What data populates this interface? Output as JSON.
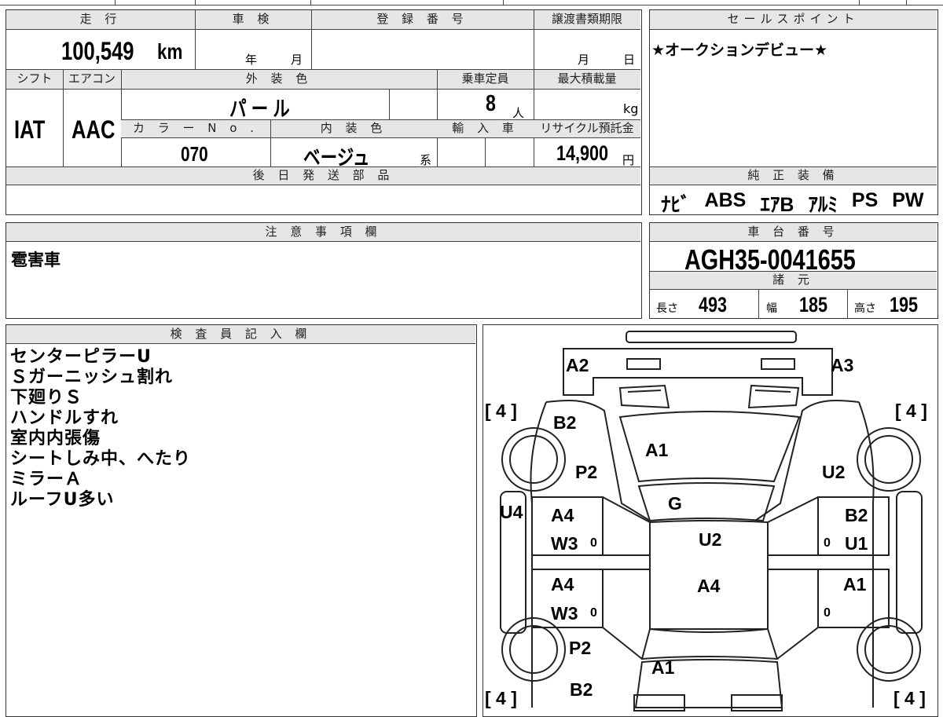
{
  "headers": {
    "mileage": "走 行",
    "inspection": "車 検",
    "registration": "登 録 番 号",
    "transfer_deadline": "譲渡書類期限",
    "sales_point": "セールスポイント",
    "shift": "シフト",
    "aircon": "エアコン",
    "exterior_color": "外 装 色",
    "capacity": "乗車定員",
    "max_load": "最大積載量",
    "color_no": "カ ラ ー N o .",
    "interior_color": "内 装 色",
    "import": "輸 入 車",
    "recycle": "リサイクル預託金",
    "later_parts": "後 日 発 送 部 品",
    "factory_equipment": "純 正 装 備",
    "notes": "注 意 事 項 欄",
    "chassis_no": "車 台 番 号",
    "specs": "諸 元",
    "inspector": "検 査 員 記 入 欄"
  },
  "values": {
    "mileage": "100,549",
    "mileage_unit": "km",
    "inspection_year": "年",
    "inspection_month": "月",
    "transfer_month": "月",
    "transfer_day": "日",
    "sales_point": "★オークションデビュー★",
    "shift": "IAT",
    "aircon": "AAC",
    "exterior_color": "パ ー ル",
    "capacity": "8",
    "capacity_unit": "人",
    "max_load_unit": "kg",
    "color_no": "070",
    "interior_color": "ベージュ",
    "interior_suffix": "系",
    "recycle": "14,900",
    "recycle_unit": "円",
    "equipment": [
      "ﾅﾋﾞ",
      "ABS",
      "ｴｱB",
      "ｱﾙﾐ",
      "PS",
      "PW"
    ],
    "notes": "雹害車",
    "chassis_no": "AGH35-0041655",
    "length_label": "長さ",
    "length": "493",
    "width_label": "幅",
    "width": "185",
    "height_label": "高さ",
    "height": "195"
  },
  "inspector_notes": [
    "センターピラーU",
    "Ｓガーニッシュ割れ",
    "下廻りＳ",
    "ハンドルすれ",
    "室内内張傷",
    "シートしみ中、へたり",
    "ミラーＡ",
    "ルーフU多い"
  ],
  "diagram": {
    "front_left_bumper": "A2",
    "front_right_bumper": "A3",
    "tire_fl": "[ 4 ]",
    "tire_fr": "[ 4 ]",
    "tire_rl": "[ 4 ]",
    "tire_rr": "[ 4 ]",
    "fender_fl_b": "B2",
    "fender_fl_p": "P2",
    "hood": "A1",
    "fender_fr": "U2",
    "windshield": "G",
    "left_rocker": "U4",
    "door_fl_a": "A4",
    "door_fl_w": "W3",
    "door_fl_mark": "0",
    "roof_front": "U2",
    "door_fr_b": "B2",
    "door_fr_u": "U1",
    "door_fr_mark": "0",
    "door_rl_a": "A4",
    "door_rl_w": "W3",
    "door_rl_mark": "0",
    "roof_rear": "A4",
    "door_rr_a": "A1",
    "door_rr_mark": "0",
    "quarter_rl_p": "P2",
    "quarter_rl_b": "B2",
    "back_door": "A1"
  }
}
